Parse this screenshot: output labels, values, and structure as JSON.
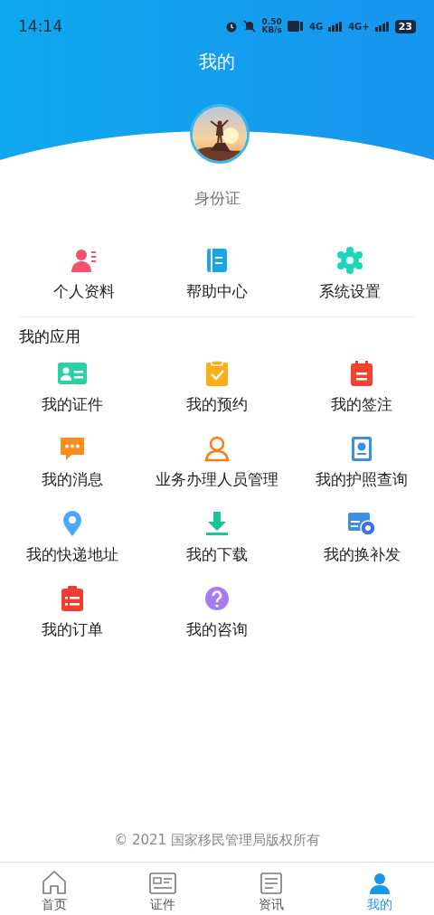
{
  "status_bar": {
    "time": "14:14",
    "speed": "0.50",
    "speed_unit": "KB/s",
    "network_1": "4G",
    "network_2": "4G+",
    "battery": "23"
  },
  "header": {
    "title": "我的"
  },
  "profile": {
    "name": "身份证"
  },
  "quick_actions": [
    {
      "label": "个人资料"
    },
    {
      "label": "帮助中心"
    },
    {
      "label": "系统设置"
    }
  ],
  "apps": {
    "title": "我的应用",
    "items": [
      {
        "label": "我的证件"
      },
      {
        "label": "我的预约"
      },
      {
        "label": "我的签注"
      },
      {
        "label": "我的消息"
      },
      {
        "label": "业务办理人员管理"
      },
      {
        "label": "我的护照查询"
      },
      {
        "label": "我的快递地址"
      },
      {
        "label": "我的下载"
      },
      {
        "label": "我的换补发"
      },
      {
        "label": "我的订单"
      },
      {
        "label": "我的咨询"
      }
    ]
  },
  "footer": {
    "copyright": "© 2021 国家移民管理局版权所有"
  },
  "tab_bar": [
    {
      "label": "首页",
      "selected": false
    },
    {
      "label": "证件",
      "selected": false
    },
    {
      "label": "资讯",
      "selected": false
    },
    {
      "label": "我的",
      "selected": true
    }
  ]
}
